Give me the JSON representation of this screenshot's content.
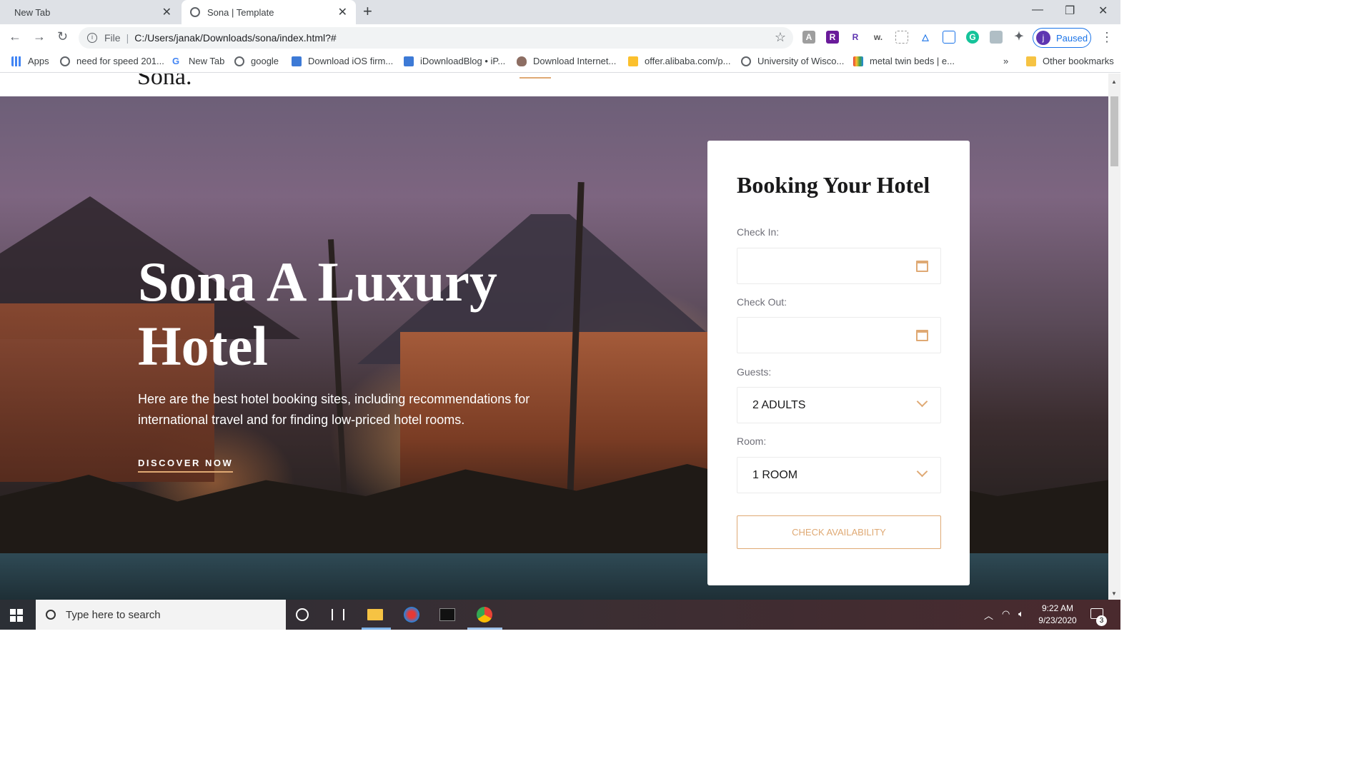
{
  "browser": {
    "tabs": [
      {
        "title": "New Tab"
      },
      {
        "title": "Sona | Template"
      }
    ],
    "address": {
      "scheme": "File",
      "url": "C:/Users/janak/Downloads/sona/index.html?#"
    },
    "profile_status": "Paused",
    "profile_initial": "j",
    "bookmarks": [
      {
        "label": "Apps"
      },
      {
        "label": "need for speed 201..."
      },
      {
        "label": "New Tab"
      },
      {
        "label": "google"
      },
      {
        "label": "Download iOS firm..."
      },
      {
        "label": "iDownloadBlog • iP..."
      },
      {
        "label": "Download Internet..."
      },
      {
        "label": "offer.alibaba.com/p..."
      },
      {
        "label": "University of Wisco..."
      },
      {
        "label": "metal twin beds | e..."
      }
    ],
    "bookmarks_overflow": "»",
    "other_bookmarks": "Other bookmarks"
  },
  "site": {
    "logo": "Sona.",
    "hero": {
      "title": "Sona A Luxury Hotel",
      "text": "Here are the best hotel booking sites, including recommendations for international travel and for finding low-priced hotel rooms.",
      "cta": "DISCOVER NOW"
    },
    "booking": {
      "title": "Booking Your Hotel",
      "check_in_label": "Check In:",
      "check_in_value": "",
      "check_out_label": "Check Out:",
      "check_out_value": "",
      "guests_label": "Guests:",
      "guests_value": "2 ADULTS",
      "room_label": "Room:",
      "room_value": "1 ROOM",
      "button": "CHECK AVAILABILITY"
    },
    "accent_color": "#dfa974"
  },
  "taskbar": {
    "search_placeholder": "Type here to search",
    "time": "9:22 AM",
    "date": "9/23/2020",
    "notification_count": "3"
  }
}
